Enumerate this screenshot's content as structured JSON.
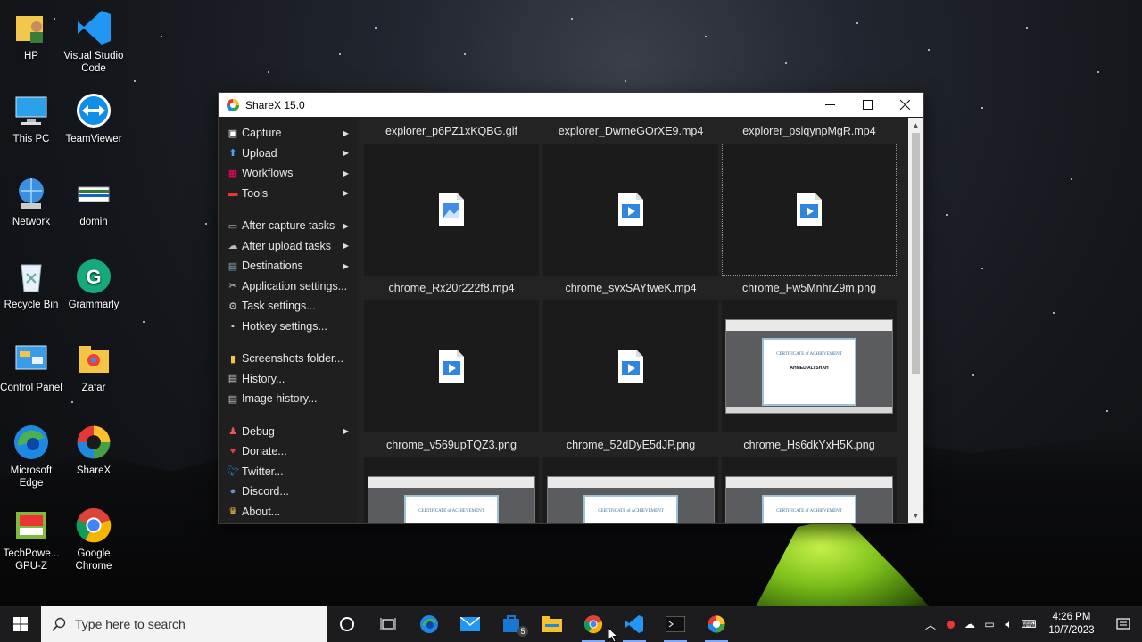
{
  "desktop": {
    "icons": [
      {
        "name": "HP",
        "icon": "user-folder-icon"
      },
      {
        "name": "Visual Studio Code",
        "icon": "vscode-icon"
      },
      {
        "name": "This PC",
        "icon": "computer-icon"
      },
      {
        "name": "TeamViewer",
        "icon": "teamviewer-icon"
      },
      {
        "name": "Network",
        "icon": "network-icon"
      },
      {
        "name": "domin",
        "icon": "document-icon"
      },
      {
        "name": "Recycle Bin",
        "icon": "recycle-bin-icon"
      },
      {
        "name": "Grammarly",
        "icon": "grammarly-icon"
      },
      {
        "name": "Control Panel",
        "icon": "control-panel-icon"
      },
      {
        "name": "Zafar",
        "icon": "folder-icon"
      },
      {
        "name": "Microsoft Edge",
        "icon": "edge-icon"
      },
      {
        "name": "ShareX",
        "icon": "sharex-icon"
      },
      {
        "name": "TechPowe... GPU-Z",
        "icon": "gpuz-icon"
      },
      {
        "name": "Google Chrome",
        "icon": "chrome-icon"
      }
    ]
  },
  "window": {
    "title": "ShareX 15.0",
    "menu": [
      {
        "label": "Capture",
        "icon": "capture-icon",
        "submenu": true
      },
      {
        "label": "Upload",
        "icon": "upload-icon",
        "submenu": true
      },
      {
        "label": "Workflows",
        "icon": "workflows-icon",
        "submenu": true
      },
      {
        "label": "Tools",
        "icon": "tools-icon",
        "submenu": true
      },
      {
        "sep": true
      },
      {
        "label": "After capture tasks",
        "icon": "after-capture-icon",
        "submenu": true
      },
      {
        "label": "After upload tasks",
        "icon": "after-upload-icon",
        "submenu": true
      },
      {
        "label": "Destinations",
        "icon": "destinations-icon",
        "submenu": true
      },
      {
        "label": "Application settings...",
        "icon": "app-settings-icon",
        "submenu": false
      },
      {
        "label": "Task settings...",
        "icon": "task-settings-icon",
        "submenu": false
      },
      {
        "label": "Hotkey settings...",
        "icon": "hotkey-icon",
        "submenu": false
      },
      {
        "sep": true
      },
      {
        "label": "Screenshots folder...",
        "icon": "folder-icon",
        "submenu": false
      },
      {
        "label": "History...",
        "icon": "history-icon",
        "submenu": false
      },
      {
        "label": "Image history...",
        "icon": "image-history-icon",
        "submenu": false
      },
      {
        "sep": true
      },
      {
        "label": "Debug",
        "icon": "debug-icon",
        "submenu": true
      },
      {
        "label": "Donate...",
        "icon": "heart-icon",
        "submenu": false
      },
      {
        "label": "Twitter...",
        "icon": "twitter-icon",
        "submenu": false
      },
      {
        "label": "Discord...",
        "icon": "discord-icon",
        "submenu": false
      },
      {
        "label": "About...",
        "icon": "crown-icon",
        "submenu": false
      }
    ],
    "files": [
      {
        "name": "explorer_p6PZ1xKQBG.gif",
        "kind": "image-file"
      },
      {
        "name": "explorer_DwmeGOrXE9.mp4",
        "kind": "video-file"
      },
      {
        "name": "explorer_psiqynpMgR.mp4",
        "kind": "video-file",
        "selected": true
      },
      {
        "name": "chrome_Rx20r222f8.mp4",
        "kind": "video-file"
      },
      {
        "name": "chrome_svxSAYtweK.mp4",
        "kind": "video-file"
      },
      {
        "name": "chrome_Fw5MnhrZ9m.png",
        "kind": "screenshot"
      },
      {
        "name": "chrome_v569upTQZ3.png",
        "kind": "screenshot"
      },
      {
        "name": "chrome_52dDyE5dJP.png",
        "kind": "screenshot"
      },
      {
        "name": "chrome_Hs6dkYxH5K.png",
        "kind": "screenshot"
      }
    ],
    "certificate_title": "CERTIFICATE of ACHIEVEMENT",
    "certificate_name": "AHMED ALI SHAH"
  },
  "taskbar": {
    "search_placeholder": "Type here to search",
    "apps": [
      "cortana-icon",
      "task-view-icon",
      "edge-icon",
      "mail-icon",
      "store-icon",
      "file-explorer-icon",
      "chrome-icon",
      "vscode-icon",
      "terminal-icon",
      "sharex-icon"
    ],
    "store_badge": "5",
    "time": "4:26 PM",
    "date": "10/7/2023"
  },
  "colors": {
    "accent": "#7aa7ff",
    "window_bg": "#1f1f1f",
    "taskbar_bg": "#1c1c1f"
  }
}
